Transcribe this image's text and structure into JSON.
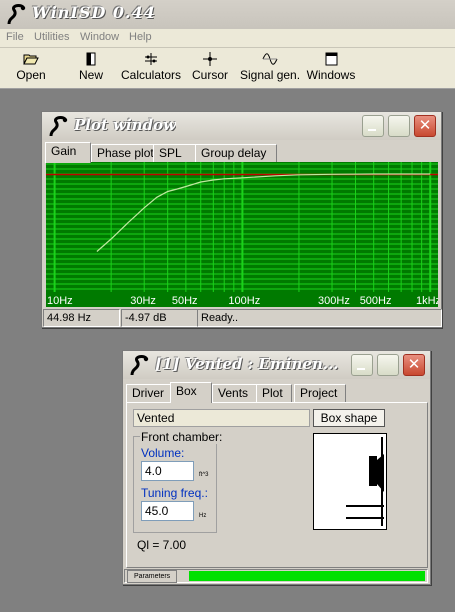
{
  "app": {
    "title": "WinISD 0.44"
  },
  "menu": [
    "File",
    "Utilities",
    "Window",
    "Help"
  ],
  "toolbar": [
    "Open",
    "New",
    "Calculators",
    "Cursor",
    "Signal gen.",
    "Windows"
  ],
  "plot_window": {
    "title": "Plot window",
    "tabs": [
      "Gain",
      "Phase plot",
      "SPL",
      "Group delay"
    ],
    "active_tab": "Gain",
    "x_ticks": [
      "10Hz",
      "30Hz",
      "50Hz",
      "100Hz",
      "300Hz",
      "500Hz",
      "1kHz"
    ],
    "status": {
      "freq": "44.98 Hz",
      "gain": "-4.97 dB",
      "state": "Ready.."
    },
    "colors": {
      "plot_bg": "#007a00",
      "grid": "#1bd21b",
      "reference": "#c00000",
      "curve": "#bfe9a0"
    }
  },
  "chart_data": {
    "type": "line",
    "x_scale": "log",
    "xlim": [
      9,
      1100
    ],
    "x_ticks": [
      "10Hz",
      "30Hz",
      "50Hz",
      "100Hz",
      "300Hz",
      "500Hz",
      "1kHz"
    ],
    "series": [
      {
        "x": [
          16.8,
          20,
          25,
          30,
          35,
          40,
          45,
          50,
          60,
          70,
          80,
          100,
          150,
          200,
          300,
          500,
          800,
          1000
        ],
        "y": [
          -30,
          -25,
          -18,
          -12.5,
          -8.3,
          -6,
          -5,
          -4,
          -2.2,
          -1.4,
          -0.9,
          -0.5,
          0.3,
          0.7,
          0.9,
          1,
          1,
          1
        ]
      }
    ],
    "reference_line": 0
  },
  "box_window": {
    "title": "[1] Vented : Eminen...",
    "tabs": [
      "Driver",
      "Box",
      "Vents",
      "Plot",
      "Project"
    ],
    "active_tab": "Box",
    "box_type": "Vented",
    "box_shape_button": "Box shape",
    "front_chamber_label": "Front chamber:",
    "volume_label": "Volume:",
    "volume_value": "4.0",
    "volume_unit": "ft^3",
    "tuning_label": "Tuning freq.:",
    "tuning_value": "45.0",
    "tuning_unit": "Hz",
    "ql_text": "Ql = 7.00",
    "status_label": "Parameters",
    "progress": 1.0,
    "colors": {
      "progress": "#00e000"
    }
  }
}
